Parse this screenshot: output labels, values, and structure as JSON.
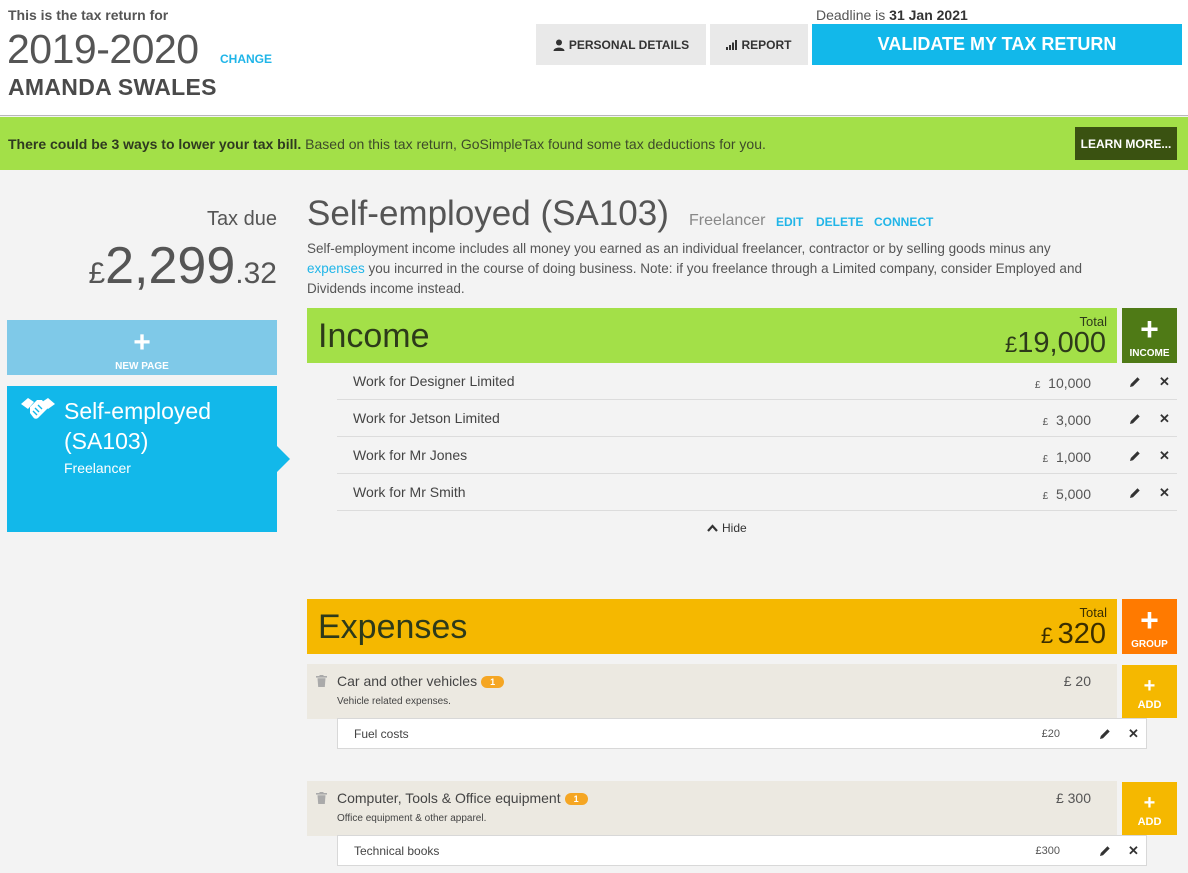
{
  "header": {
    "intro": "This is the tax return for",
    "year": "2019-2020",
    "change": "CHANGE",
    "name": "AMANDA SWALES",
    "deadline_label": "Deadline is",
    "deadline_date": "31 Jan 2021",
    "personal_details": "PERSONAL DETAILS",
    "report": "REPORT",
    "validate": "VALIDATE MY TAX RETURN"
  },
  "banner": {
    "bold": "There could be 3 ways to lower your tax bill.",
    "text": " Based on this tax return, GoSimpleTax found some tax deductions for you.",
    "learn_more": "LEARN MORE..."
  },
  "sidebar": {
    "tax_due_label": "Tax due",
    "tax_due_currency": "£",
    "tax_due_main": "2,299",
    "tax_due_pence": ".32",
    "new_page": "NEW PAGE",
    "card_title": "Self-employed (SA103)",
    "card_subtitle": "Freelancer"
  },
  "main": {
    "title": "Self-employed (SA103)",
    "subtitle": "Freelancer",
    "edit": "EDIT",
    "delete": "DELETE",
    "connect": "CONNECT",
    "desc_1": "Self-employment income includes all money you earned as an individual freelancer, contractor or by selling goods minus any ",
    "desc_link": "expenses",
    "desc_2": " you incurred in the course of doing business. Note: if you freelance through a Limited company, consider Employed and Dividends income instead."
  },
  "income": {
    "title": "Income",
    "total_label": "Total",
    "total_currency": "£",
    "total_value": "19,000",
    "button": "INCOME",
    "rows": [
      {
        "name": "Work for Designer Limited",
        "currency": "£",
        "amount": "10,000"
      },
      {
        "name": "Work for Jetson Limited",
        "currency": "£",
        "amount": "3,000"
      },
      {
        "name": "Work for Mr Jones",
        "currency": "£",
        "amount": "1,000"
      },
      {
        "name": "Work for Mr Smith",
        "currency": "£",
        "amount": "5,000"
      }
    ],
    "hide": "Hide"
  },
  "expenses": {
    "title": "Expenses",
    "total_label": "Total",
    "total_currency": "£",
    "total_value": "320",
    "button": "GROUP",
    "add_label": "ADD",
    "groups": [
      {
        "name": "Car and other vehicles",
        "badge": "1",
        "desc": "Vehicle related expenses.",
        "amount": "£ 20",
        "items": [
          {
            "name": "Fuel costs",
            "amount": "£20"
          }
        ]
      },
      {
        "name": "Computer, Tools & Office equipment",
        "badge": "1",
        "desc": "Office equipment & other apparel.",
        "amount": "£ 300",
        "items": [
          {
            "name": "Technical books",
            "amount": "£300"
          }
        ]
      }
    ]
  },
  "colors": {
    "accent_blue": "#12b8ea",
    "income_green": "#a3e048",
    "income_button": "#4f7a16",
    "expenses_orange": "#f5b800",
    "group_button": "#ff7a00"
  }
}
